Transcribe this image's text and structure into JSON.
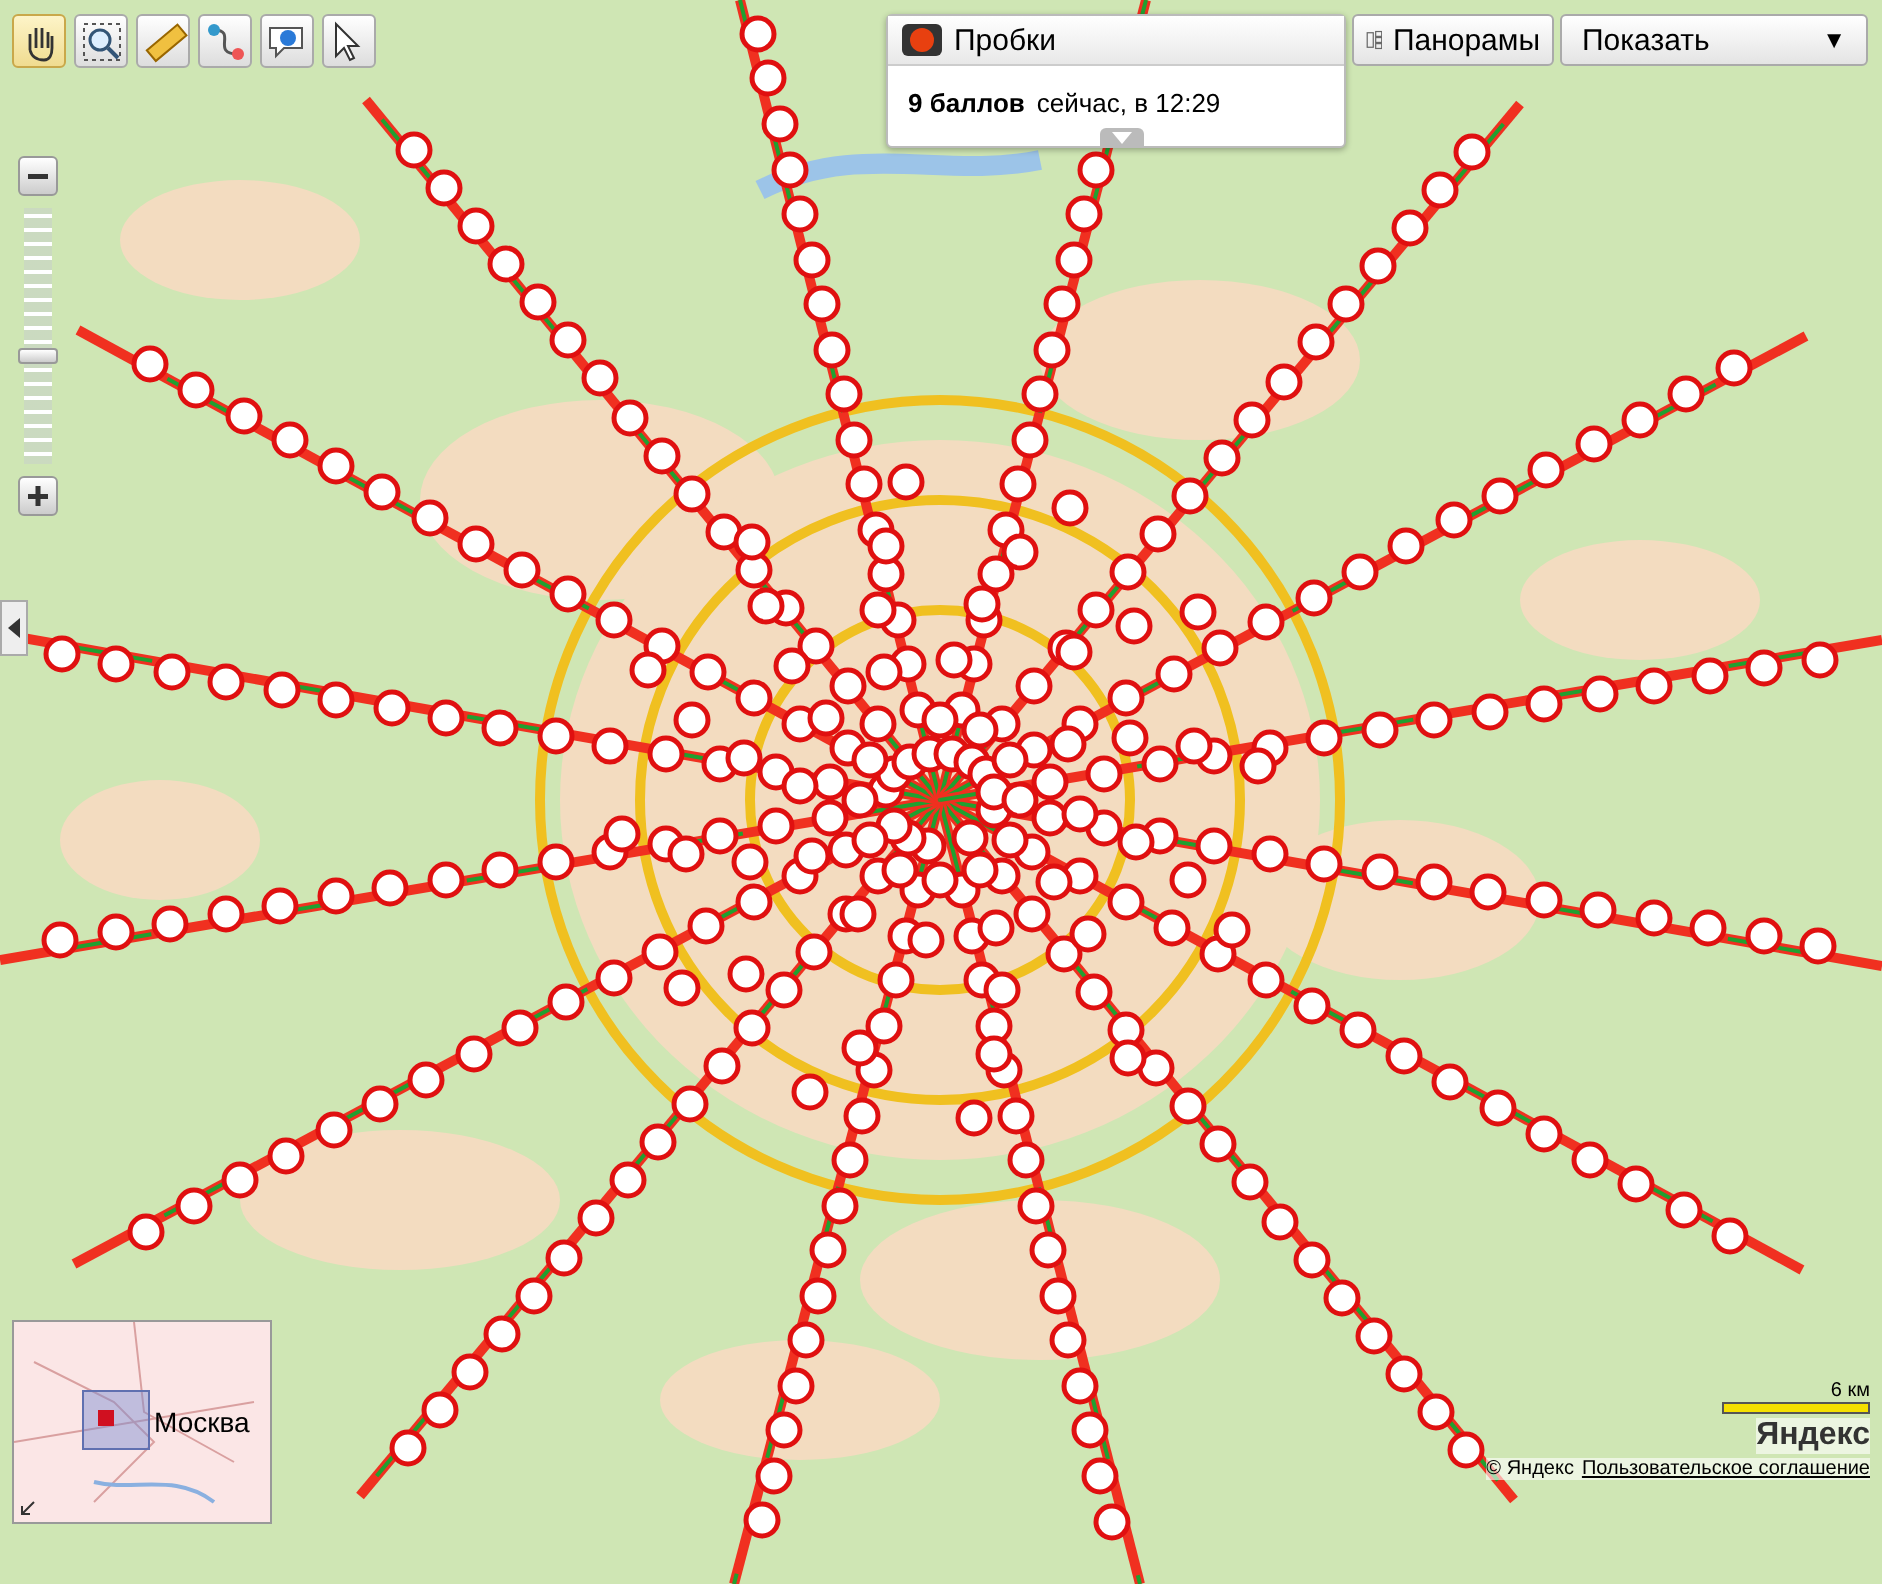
{
  "toolbar": {
    "tools": [
      {
        "kind": "hand",
        "selected": true
      },
      {
        "kind": "magnifier",
        "selected": false
      },
      {
        "kind": "ruler",
        "selected": false
      },
      {
        "kind": "route",
        "selected": false
      },
      {
        "kind": "add-point",
        "selected": false
      },
      {
        "kind": "help",
        "selected": false
      }
    ]
  },
  "traffic": {
    "label": "Пробки",
    "score": "9 баллов",
    "time": "сейчас, в 12:29"
  },
  "panoramas": {
    "label": "Панорамы"
  },
  "show": {
    "label": "Показать",
    "caret": "▼"
  },
  "zoom": {
    "level": 0.42
  },
  "minimap": {
    "label": "Москва"
  },
  "scale": {
    "label": "6 км"
  },
  "logo": "Яндекс",
  "copyright": "© Яндекс",
  "agreement": "Пользовательское соглашение"
}
